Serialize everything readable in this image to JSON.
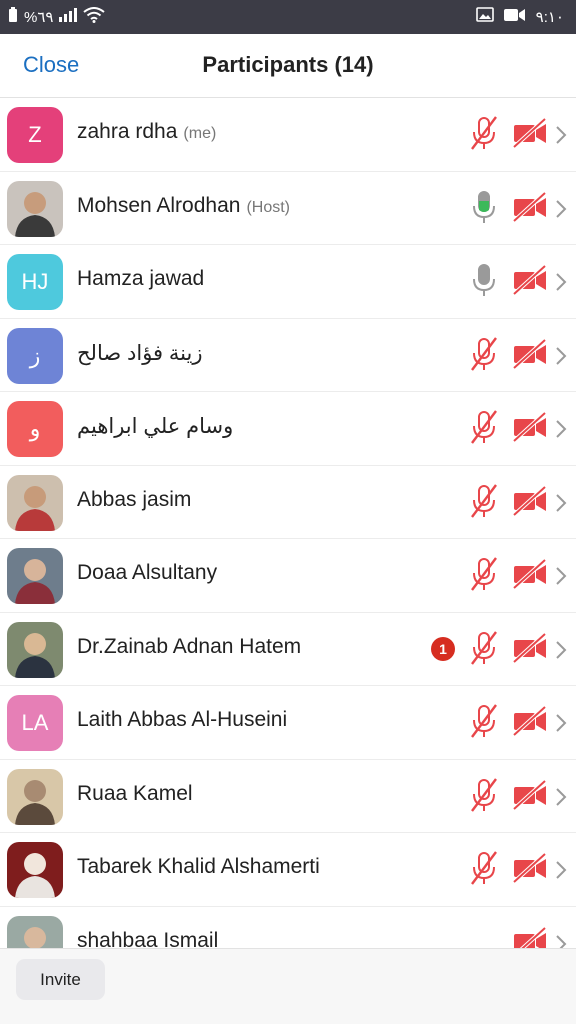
{
  "status_bar": {
    "battery_text": "%٦٩",
    "time": "٩:١٠",
    "icons": [
      "battery-icon",
      "signal-icon",
      "wifi-icon",
      "gallery-icon",
      "video-icon"
    ]
  },
  "header": {
    "close_label": "Close",
    "title": "Participants (14)"
  },
  "participants": [
    {
      "name": "zahra rdha",
      "tag": "(me)",
      "avatar_text": "Z",
      "avatar_color": "#e4407a",
      "mic": "muted",
      "video": "off"
    },
    {
      "name": "Mohsen Alrodhan",
      "tag": "(Host)",
      "avatar_text": "",
      "avatar_type": "photo",
      "mic": "active",
      "video": "off"
    },
    {
      "name": "Hamza jawad",
      "tag": "",
      "avatar_text": "HJ",
      "avatar_color": "#4ec9dd",
      "mic": "on",
      "video": "off"
    },
    {
      "name": "زينة فؤاد صالح",
      "tag": "",
      "avatar_text": "ز",
      "avatar_color": "#6e84d6",
      "mic": "muted",
      "video": "off"
    },
    {
      "name": "وسام علي ابراهيم",
      "tag": "",
      "avatar_text": "و",
      "avatar_color": "#f25d5d",
      "mic": "muted",
      "video": "off"
    },
    {
      "name": "Abbas jasim",
      "tag": "",
      "avatar_text": "",
      "avatar_type": "photo",
      "mic": "muted",
      "video": "off"
    },
    {
      "name": "Doaa Alsultany",
      "tag": "",
      "avatar_text": "",
      "avatar_type": "photo",
      "mic": "muted",
      "video": "off"
    },
    {
      "name": "Dr.Zainab Adnan Hatem",
      "tag": "",
      "avatar_text": "",
      "avatar_type": "photo",
      "badge": "1",
      "mic": "muted",
      "video": "off"
    },
    {
      "name": "Laith Abbas Al-Huseini",
      "tag": "",
      "avatar_text": "LA",
      "avatar_color": "#e67fb6",
      "mic": "muted",
      "video": "off"
    },
    {
      "name": "Ruaa Kamel",
      "tag": "",
      "avatar_text": "",
      "avatar_type": "photo",
      "mic": "muted",
      "video": "off"
    },
    {
      "name": "Tabarek Khalid Alshamerti",
      "tag": "",
      "avatar_text": "",
      "avatar_type": "photo",
      "mic": "muted",
      "video": "off"
    },
    {
      "name": "shahbaa Ismail",
      "tag": "",
      "avatar_text": "",
      "avatar_type": "photo",
      "mic": "none",
      "video": "off"
    }
  ],
  "footer": {
    "invite_label": "Invite"
  },
  "colors": {
    "accent": "#1b6fc1",
    "muted_red": "#e8464a",
    "mic_active_green": "#3cb95a",
    "mic_gray": "#9a9a9a",
    "badge_red": "#d62d20"
  }
}
